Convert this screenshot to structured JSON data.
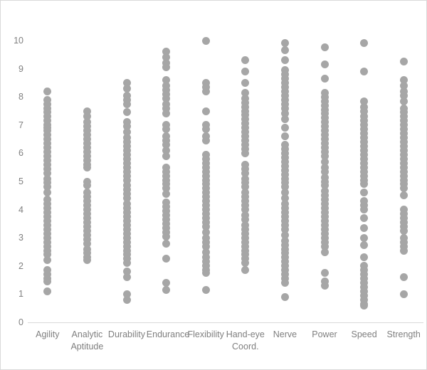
{
  "chart_data": {
    "type": "scatter",
    "title": "",
    "xlabel": "",
    "ylabel": "",
    "ylim": [
      0,
      10
    ],
    "y_ticks": [
      0,
      1,
      2,
      3,
      4,
      5,
      6,
      7,
      8,
      9,
      10
    ],
    "y_tick_labels": [
      "0",
      "1",
      "2",
      "3",
      "4",
      "5",
      "6",
      "7",
      "8",
      "9",
      "10"
    ],
    "grid": false,
    "legend": "none",
    "marker": "circle",
    "marker_color": "#a6a6a6",
    "marker_diameter_px": 11,
    "categories": [
      "Agility",
      "Analytic\nAptitude",
      "Durability",
      "Endurance",
      "Flexibility",
      "Hand-eye\nCoord.",
      "Nerve",
      "Power",
      "Speed",
      "Strength"
    ],
    "series": [
      {
        "name": "Agility",
        "values": [
          8.2,
          7.9,
          7.75,
          7.6,
          7.45,
          7.3,
          7.15,
          7.0,
          6.9,
          6.8,
          6.65,
          6.5,
          6.35,
          6.2,
          6.05,
          5.9,
          5.75,
          5.6,
          5.45,
          5.3,
          5.1,
          4.95,
          4.8,
          4.6,
          4.35,
          4.2,
          4.05,
          3.9,
          3.75,
          3.6,
          3.45,
          3.3,
          3.15,
          3.0,
          2.85,
          2.7,
          2.55,
          2.4,
          2.2,
          1.85,
          1.7,
          1.55,
          1.45,
          1.1
        ]
      },
      {
        "name": "Analytic Aptitude",
        "values": [
          7.5,
          7.3,
          7.1,
          6.95,
          6.8,
          6.65,
          6.5,
          6.35,
          6.2,
          6.05,
          5.9,
          5.75,
          5.6,
          5.5,
          5.0,
          4.85,
          4.6,
          4.45,
          4.3,
          4.15,
          4.0,
          3.85,
          3.7,
          3.55,
          3.4,
          3.25,
          3.1,
          2.95,
          2.8,
          2.6,
          2.45,
          2.3,
          2.2
        ]
      },
      {
        "name": "Durability",
        "values": [
          8.5,
          8.3,
          8.05,
          7.9,
          7.75,
          7.45,
          7.1,
          6.95,
          6.75,
          6.55,
          6.4,
          6.25,
          6.1,
          5.95,
          5.8,
          5.65,
          5.5,
          5.35,
          5.2,
          5.05,
          4.85,
          4.7,
          4.55,
          4.4,
          4.2,
          4.05,
          3.9,
          3.75,
          3.6,
          3.45,
          3.3,
          3.15,
          3.0,
          2.85,
          2.7,
          2.55,
          2.4,
          2.25,
          2.1,
          1.8,
          1.6,
          1.0,
          0.8
        ]
      },
      {
        "name": "Endurance",
        "values": [
          9.6,
          9.4,
          9.2,
          9.05,
          8.6,
          8.4,
          8.25,
          8.1,
          7.95,
          7.75,
          7.6,
          7.4,
          7.0,
          6.85,
          6.6,
          6.45,
          6.3,
          6.1,
          5.9,
          5.5,
          5.35,
          5.2,
          5.05,
          4.9,
          4.75,
          4.55,
          4.25,
          4.1,
          3.95,
          3.8,
          3.65,
          3.5,
          3.35,
          3.2,
          3.05,
          2.8,
          2.25,
          1.4,
          1.15
        ]
      },
      {
        "name": "Flexibility",
        "values": [
          10.0,
          8.5,
          8.35,
          8.2,
          7.5,
          7.0,
          6.85,
          6.6,
          6.45,
          5.95,
          5.8,
          5.65,
          5.5,
          5.35,
          5.2,
          5.05,
          4.9,
          4.75,
          4.6,
          4.45,
          4.3,
          4.15,
          4.0,
          3.85,
          3.7,
          3.55,
          3.4,
          3.2,
          3.0,
          2.85,
          2.7,
          2.5,
          2.3,
          2.15,
          2.0,
          1.85,
          1.75,
          1.15
        ]
      },
      {
        "name": "Hand-eye Coord.",
        "values": [
          9.3,
          8.9,
          8.5,
          8.15,
          7.95,
          7.8,
          7.65,
          7.5,
          7.35,
          7.2,
          7.05,
          6.9,
          6.75,
          6.6,
          6.45,
          6.3,
          6.15,
          6.0,
          5.6,
          5.45,
          5.3,
          5.1,
          4.95,
          4.8,
          4.6,
          4.45,
          4.3,
          4.15,
          4.0,
          3.8,
          3.65,
          3.45,
          3.3,
          3.15,
          3.0,
          2.85,
          2.7,
          2.55,
          2.4,
          2.25,
          2.1,
          1.85
        ]
      },
      {
        "name": "Nerve",
        "values": [
          9.9,
          9.65,
          9.3,
          8.95,
          8.8,
          8.65,
          8.5,
          8.35,
          8.2,
          8.05,
          7.9,
          7.75,
          7.6,
          7.4,
          7.2,
          6.9,
          6.6,
          6.3,
          6.15,
          6.0,
          5.85,
          5.7,
          5.55,
          5.4,
          5.25,
          5.1,
          4.95,
          4.8,
          4.6,
          4.4,
          4.2,
          4.05,
          3.9,
          3.75,
          3.6,
          3.45,
          3.3,
          3.1,
          2.9,
          2.75,
          2.6,
          2.45,
          2.3,
          2.15,
          2.0,
          1.85,
          1.7,
          1.55,
          1.4,
          0.9
        ]
      },
      {
        "name": "Power",
        "values": [
          9.75,
          9.15,
          8.65,
          8.15,
          8.0,
          7.85,
          7.7,
          7.55,
          7.4,
          7.25,
          7.1,
          6.95,
          6.8,
          6.65,
          6.5,
          6.35,
          6.2,
          6.05,
          5.9,
          5.7,
          5.5,
          5.35,
          5.15,
          5.0,
          4.85,
          4.65,
          4.5,
          4.35,
          4.2,
          4.05,
          3.9,
          3.75,
          3.6,
          3.45,
          3.3,
          3.15,
          3.0,
          2.85,
          2.7,
          2.5,
          1.75,
          1.45,
          1.3
        ]
      },
      {
        "name": "Speed",
        "values": [
          9.9,
          8.9,
          7.85,
          7.65,
          7.5,
          7.3,
          7.15,
          7.0,
          6.85,
          6.7,
          6.55,
          6.4,
          6.25,
          6.1,
          5.95,
          5.8,
          5.65,
          5.5,
          5.35,
          5.2,
          5.05,
          4.9,
          4.6,
          4.3,
          4.15,
          4.0,
          3.7,
          3.35,
          3.0,
          2.75,
          2.3,
          2.0,
          1.85,
          1.7,
          1.55,
          1.4,
          1.25,
          1.1,
          0.95,
          0.8,
          0.65,
          0.6
        ]
      },
      {
        "name": "Strength",
        "values": [
          9.25,
          8.6,
          8.4,
          8.2,
          8.05,
          7.85,
          7.6,
          7.45,
          7.3,
          7.15,
          7.0,
          6.85,
          6.7,
          6.55,
          6.4,
          6.25,
          6.1,
          5.95,
          5.8,
          5.65,
          5.5,
          5.35,
          5.2,
          5.05,
          4.9,
          4.75,
          4.5,
          4.0,
          3.85,
          3.7,
          3.55,
          3.4,
          3.25,
          3.0,
          2.85,
          2.7,
          2.55,
          1.6,
          1.0
        ]
      }
    ]
  }
}
